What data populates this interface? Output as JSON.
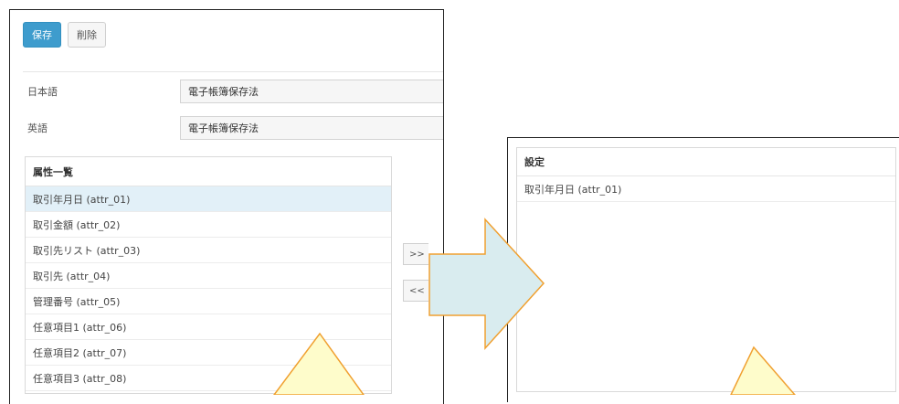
{
  "toolbar": {
    "save_label": "保存",
    "delete_label": "削除",
    "save_color": "#3e9ccd"
  },
  "fields": {
    "japanese": {
      "label": "日本語",
      "value": "電子帳簿保存法"
    },
    "english": {
      "label": "英語",
      "value": "電子帳簿保存法"
    }
  },
  "attribute_list": {
    "title": "属性一覧",
    "items": [
      "取引年月日 (attr_01)",
      "取引金額 (attr_02)",
      "取引先リスト (attr_03)",
      "取引先 (attr_04)",
      "管理番号 (attr_05)",
      "任意項目1 (attr_06)",
      "任意項目2 (attr_07)",
      "任意項目3 (attr_08)"
    ],
    "selected_index": 0
  },
  "move_buttons": {
    "add": ">>",
    "remove": "<<"
  },
  "settings": {
    "title": "設定",
    "items": [
      "取引年月日 (attr_01)"
    ]
  },
  "annotation_colors": {
    "arrow_fill": "#d9ecef",
    "arrow_stroke": "#f0a030",
    "callout_fill": "#fefccb",
    "callout_stroke": "#f0a030"
  }
}
